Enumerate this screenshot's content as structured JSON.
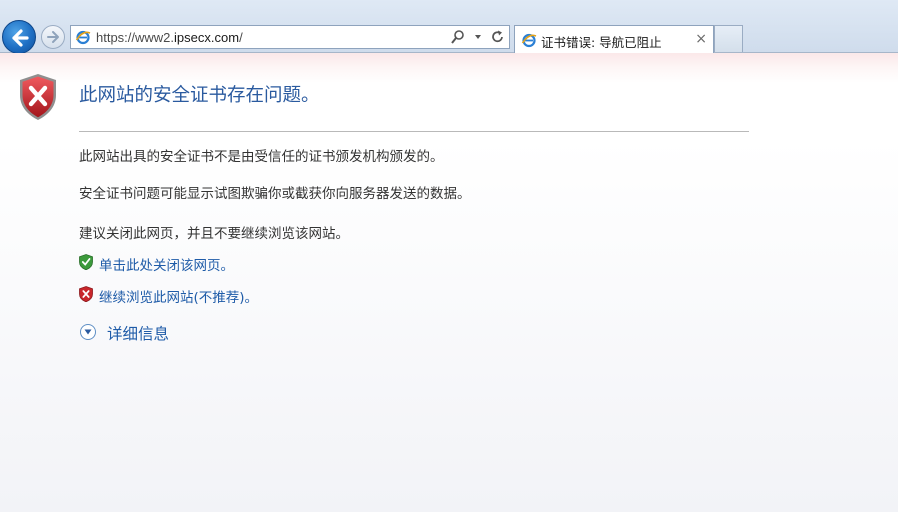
{
  "browser": {
    "back_icon": "back-arrow-icon",
    "forward_icon": "forward-arrow-icon",
    "address": {
      "url_prefix": "https://www2.",
      "url_domain": "ipsecx.com",
      "url_suffix": "/"
    },
    "tab": {
      "title": "证书错误: 导航已阻止",
      "close_label": "×"
    }
  },
  "page": {
    "headline": "此网站的安全证书存在问题。",
    "paragraphs": [
      "此网站出具的安全证书不是由受信任的证书颁发机构颁发的。",
      "安全证书问题可能显示试图欺骗你或截获你向服务器发送的数据。",
      "建议关闭此网页，并且不要继续浏览该网站。"
    ],
    "close_link": "单击此处关闭该网页。",
    "continue_link": "继续浏览此网站(不推荐)。",
    "more_info": "详细信息"
  },
  "colors": {
    "accent": "#1e5ba8",
    "headline": "#2a5a9f",
    "error_red": "#c8262b",
    "safe_green": "#3c9a3c"
  }
}
